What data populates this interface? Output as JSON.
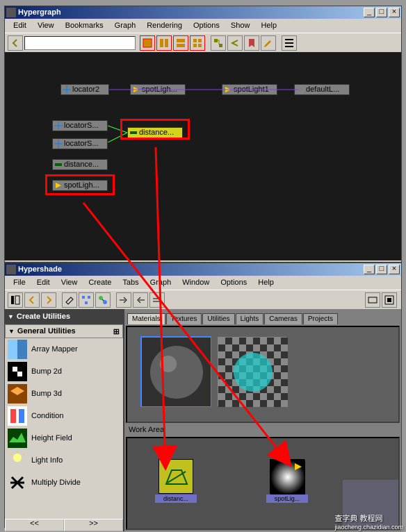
{
  "hypergraph": {
    "title": "Hypergraph",
    "menu": [
      "Edit",
      "View",
      "Bookmarks",
      "Graph",
      "Rendering",
      "Options",
      "Show",
      "Help"
    ],
    "nodes": {
      "locator2": "locator2",
      "spotLigh_a": "spotLigh...",
      "spotLight1": "spotLight1",
      "defaultL": "defaultL...",
      "locatorS1": "locatorS...",
      "locatorS2": "locatorS...",
      "distance_yellow": "distance...",
      "distance2": "distance...",
      "spotLigh_b": "spotLigh..."
    }
  },
  "hypershade": {
    "title": "Hypershade",
    "menu": [
      "File",
      "Edit",
      "View",
      "Create",
      "Tabs",
      "Graph",
      "Window",
      "Options",
      "Help"
    ],
    "create_utilities": "Create Utilities",
    "category": "General Utilities",
    "items": [
      "Array Mapper",
      "Bump 2d",
      "Bump 3d",
      "Condition",
      "Height Field",
      "Light Info",
      "Multiply Divide"
    ],
    "tabs": [
      "Materials",
      "Textures",
      "Utilities",
      "Lights",
      "Cameras",
      "Projects"
    ],
    "work_area": "Work Area",
    "wnodes": {
      "distance": "distanc...",
      "spotlig": "spotLig..."
    },
    "pager": {
      "prev": "<<",
      "next": ">>"
    }
  },
  "watermark": {
    "main": "查字典 教程网",
    "sub": "jiaocheng.chazidian.com"
  }
}
